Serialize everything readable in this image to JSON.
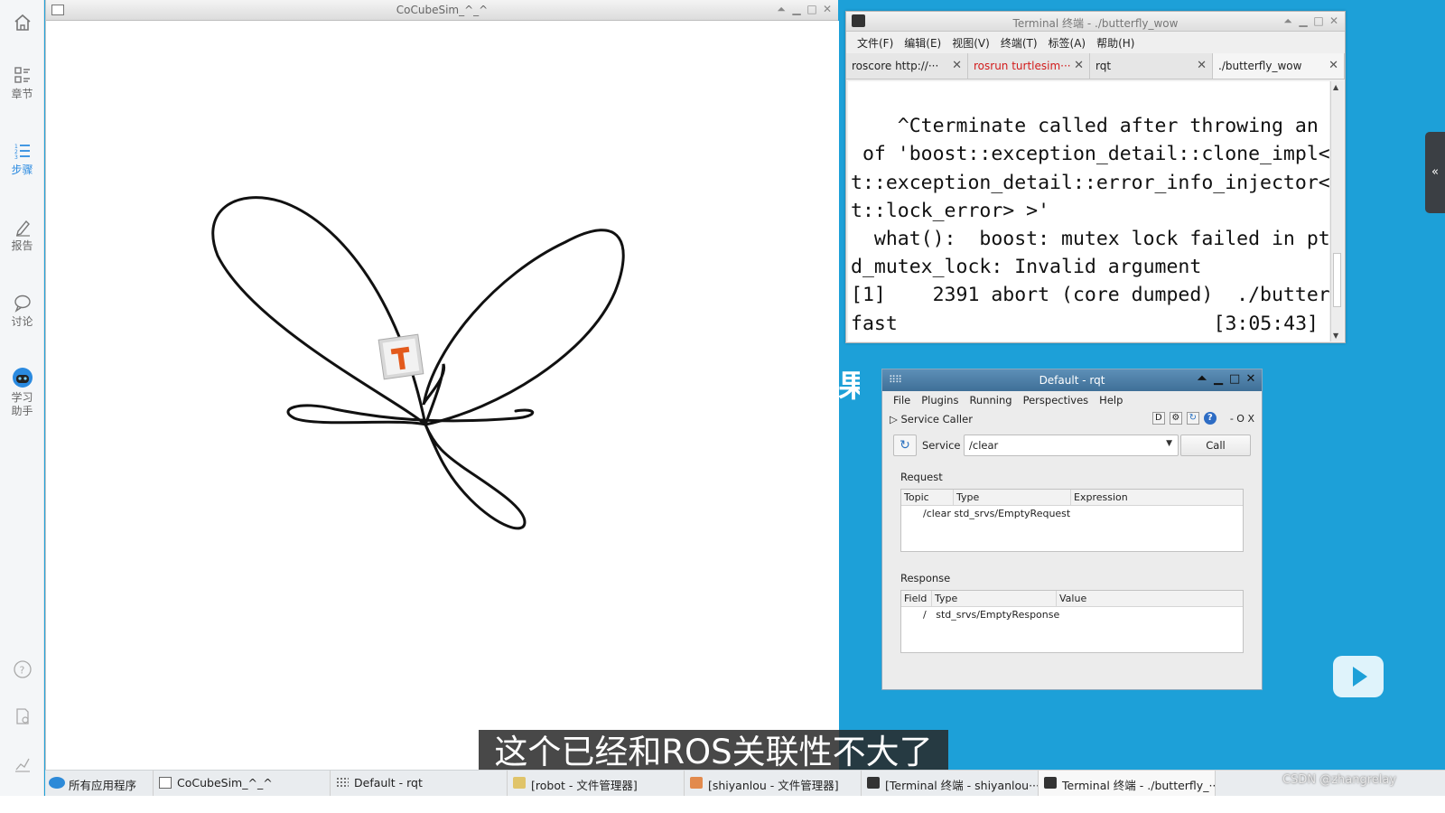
{
  "sidebar": {
    "items": [
      {
        "label": "",
        "icon": "home-icon"
      },
      {
        "label": "章节",
        "icon": "chapter-icon"
      },
      {
        "label": "步骤",
        "icon": "steps-icon"
      },
      {
        "label": "报告",
        "icon": "report-icon"
      },
      {
        "label": "讨论",
        "icon": "discussion-icon"
      },
      {
        "label": "学习\n助手",
        "icon": "assistant-icon"
      }
    ],
    "active_color": "#2a8ae0"
  },
  "sim": {
    "title": "CoCubeSim_^_^"
  },
  "terminal": {
    "title": "Terminal 终端 - ./butterfly_wow",
    "menu": [
      "文件(F)",
      "编辑(E)",
      "视图(V)",
      "终端(T)",
      "标签(A)",
      "帮助(H)"
    ],
    "tabs": [
      "roscore http://···",
      "rosrun turtlesim···",
      "rqt",
      "./butterfly_wow"
    ],
    "output": "^Cterminate called after throwing an instance\n of 'boost::exception_detail::clone_impl<boos\nt::exception_detail::error_info_injector<boos\nt::lock_error> >'\n  what():  boost: mutex lock failed in pthrea\nd_mutex_lock: Invalid argument\n[1]    2391 abort (core dumped)  ./butterfly_\nfast",
    "time": "[3:05:43]"
  },
  "rqt": {
    "title": "Default - rqt",
    "menu": [
      "File",
      "Plugins",
      "Running",
      "Perspectives",
      "Help"
    ],
    "plugin_label": "Service Caller",
    "plugin_tools": [
      "D",
      "- O X"
    ],
    "service_label": "Service",
    "service_value": "/clear",
    "call_label": "Call",
    "request_label": "Request",
    "request_headers": [
      "Topic",
      "Type",
      "Expression"
    ],
    "request_row": {
      "topic": "/clear",
      "type": "std_srvs/EmptyRequest"
    },
    "response_label": "Response",
    "response_headers": [
      "Field",
      "Type",
      "Value"
    ],
    "response_row": {
      "field": "/",
      "type": "std_srvs/EmptyResponse"
    }
  },
  "subtitle": "这个已经和ROS关联性不大了",
  "taskbar": {
    "items": [
      "所有应用程序",
      "CoCubeSim_^_^",
      "Default - rqt",
      "[robot - 文件管理器]",
      "[shiyanlou - 文件管理器]",
      "[Terminal 终端 - shiyanlou···",
      "Terminal 终端 - ./butterfly_···"
    ]
  },
  "watermark": "CSDN @zhangrelay",
  "colors": {
    "desktop": "#1da0d8",
    "rqt_title": "#4b7ea8",
    "tab_red": "#d21b1b"
  }
}
